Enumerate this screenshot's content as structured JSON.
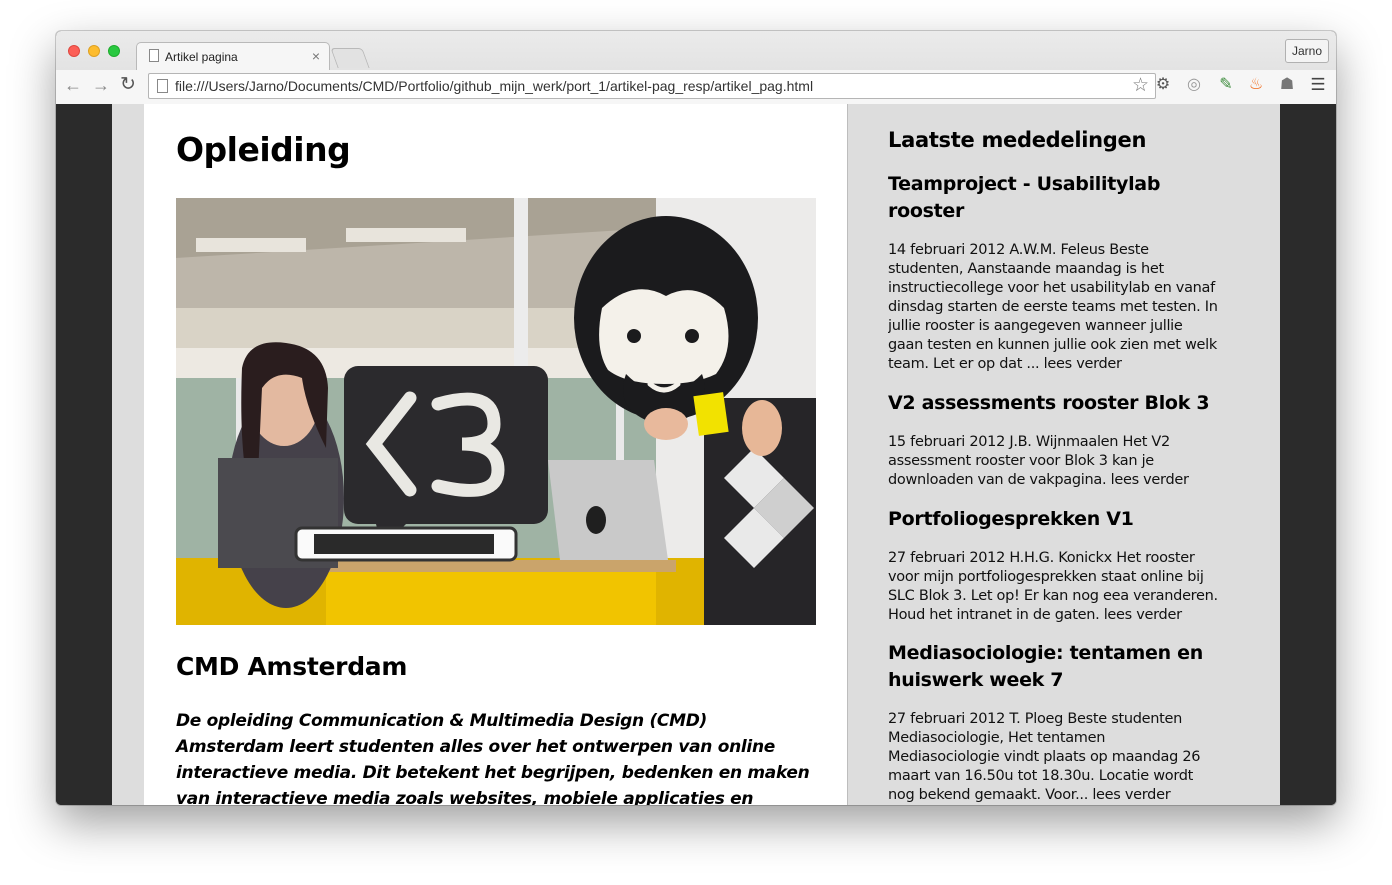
{
  "browser": {
    "tab_title": "Artikel pagina",
    "tab_close": "×",
    "profile_name": "Jarno",
    "url": "file:///Users/Jarno/Documents/CMD/Portfolio/github_mijn_werk/port_1/artikel-pag_resp/artikel_pag.html",
    "icons": {
      "back": "←",
      "forward": "→",
      "reload": "↻",
      "star": "☆",
      "gear": "⚙",
      "disable": "◎",
      "dropper": "✎",
      "flame": "♨",
      "ghost": "☗",
      "menu": "☰"
    }
  },
  "page": {
    "heading": "Opleiding",
    "hero_image": "cmd-students-photo",
    "subheading": "CMD Amsterdam",
    "intro": "De opleiding Communication & Multimedia Design (CMD) Amsterdam leert studenten alles over het ontwerpen van online interactieve media. Dit betekent het begrijpen, bedenken en maken van interactieve media zoals websites, mobiele applicaties en interactieve televisie."
  },
  "sidebar": {
    "title": "Laatste mededelingen",
    "items": [
      {
        "title": "Teamproject - Usabilitylab rooster",
        "text": "14 februari 2012 A.W.M. Feleus Beste studenten, Aanstaande maandag is het instructiecollege voor het usabilitylab en vanaf dinsdag starten de eerste teams met testen. In jullie rooster is aangegeven wanneer jullie gaan testen en kunnen jullie ook zien met welk team. Let er op dat ... lees verder"
      },
      {
        "title": "V2 assessments rooster Blok 3",
        "text": "15 februari 2012 J.B. Wijnmaalen Het V2 assessment rooster voor Blok 3 kan je downloaden van de vakpagina. lees verder"
      },
      {
        "title": "Portfoliogesprekken V1",
        "text": "27 februari 2012 H.H.G. Konickx Het rooster voor mijn portfoliogesprekken staat online bij SLC Blok 3. Let op! Er kan nog eea veranderen. Houd het intranet in de gaten. lees verder"
      },
      {
        "title": "Mediasociologie: tentamen en huiswerk week 7",
        "text": "27 februari 2012 T. Ploeg Beste studenten Mediasociologie, Het tentamen Mediasociologie vindt plaats op maandag 26 maart van 16.50u tot 18.30u. Locatie wordt nog bekend gemaakt. Voor... lees verder"
      }
    ]
  }
}
